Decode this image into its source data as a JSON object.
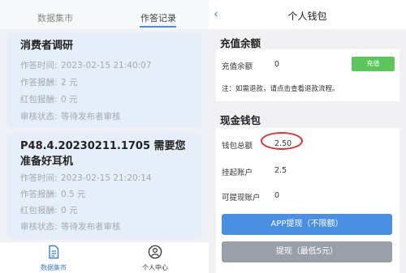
{
  "left": {
    "tabs": [
      "数据集市",
      "作答记录"
    ],
    "active_tab": "作答记录",
    "records": [
      {
        "title": "消费者调研",
        "fields": [
          {
            "label": "作答时间:",
            "value": "2023-02-15 21:40:07"
          },
          {
            "label": "作答报酬:",
            "value": "2 元"
          },
          {
            "label": "红包报酬:",
            "value": "0 元"
          },
          {
            "label": "审核状态:",
            "value": "等待发布者审核"
          }
        ]
      },
      {
        "title": "P48.4.20230211.1705 需要您准备好耳机",
        "fields": [
          {
            "label": "作答时间:",
            "value": "2023-02-15 21:20:14"
          },
          {
            "label": "作答报酬:",
            "value": "0.5 元"
          },
          {
            "label": "红包报酬:",
            "value": "0 元"
          },
          {
            "label": "审核状态:",
            "value": "等待发布者审核"
          }
        ]
      }
    ],
    "bottom_nav": [
      {
        "label": "数据集市",
        "icon": "document-icon"
      },
      {
        "label": "个人中心",
        "icon": "user-icon"
      }
    ]
  },
  "right": {
    "header": {
      "title": "个人钱包",
      "back_icon": "chevron-left-icon"
    },
    "recharge": {
      "section_title": "充值余额",
      "balance_label": "充值余额",
      "balance_value": "0",
      "button": "充值",
      "note": "注：如需退款，请点击查看退款流程。"
    },
    "cash": {
      "section_title": "现金钱包",
      "total_label": "钱包总额",
      "total_value": "2.50",
      "pending_label": "挂起账户",
      "pending_value": "2.5",
      "withdrawable_label": "可提现账户",
      "withdrawable_value": "0",
      "app_button": "APP提现（不限额）",
      "withdraw_button": "提现（最低5元）"
    }
  },
  "colors": {
    "accent": "#4a90e2",
    "green": "#5cc65a",
    "annotation": "#e03030"
  }
}
